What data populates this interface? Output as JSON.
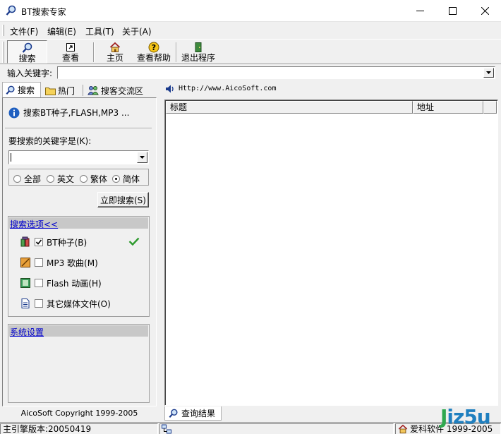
{
  "window": {
    "title": "BT搜索专家"
  },
  "menu": {
    "items": [
      "文件(F)",
      "编辑(E)",
      "工具(T)",
      "关于(A)"
    ]
  },
  "toolbar": {
    "buttons": [
      {
        "label": "搜索",
        "icon": "search-icon",
        "pressed": true
      },
      {
        "label": "查看",
        "icon": "view-icon",
        "pressed": false
      },
      {
        "label": "主页",
        "icon": "home-icon",
        "pressed": false
      },
      {
        "label": "查看帮助",
        "icon": "help-icon",
        "pressed": false
      },
      {
        "label": "退出程序",
        "icon": "exit-icon",
        "pressed": false
      }
    ]
  },
  "keyword_bar": {
    "label": "输入关键字:",
    "value": ""
  },
  "left_tabs": [
    "搜索",
    "热门",
    "搜客交流区"
  ],
  "search_panel": {
    "info": "搜索BT种子,FLASH,MP3 ...",
    "keyword_label": "要搜索的关键字是(K):",
    "keyword_value": "",
    "radios": [
      {
        "label": "全部",
        "checked": false
      },
      {
        "label": "英文",
        "checked": false
      },
      {
        "label": "繁体",
        "checked": false
      },
      {
        "label": "简体",
        "checked": true
      }
    ],
    "search_button": "立即搜索(S)",
    "options_header": "搜索选项<<",
    "options": [
      {
        "label": "BT种子(B)",
        "checked": true,
        "icon": "bt-seed-icon"
      },
      {
        "label": "MP3 歌曲(M)",
        "checked": false,
        "icon": "mp3-icon"
      },
      {
        "label": "Flash 动画(H)",
        "checked": false,
        "icon": "flash-icon"
      },
      {
        "label": "其它媒体文件(O)",
        "checked": false,
        "icon": "document-icon"
      }
    ],
    "settings_header": "系统设置"
  },
  "left_footer": "AicoSoft Copyright 1999-2005",
  "address": {
    "url": "Http://www.AicoSoft.com"
  },
  "results": {
    "columns": [
      "标题",
      "地址"
    ],
    "tab_label": "查询结果"
  },
  "status": {
    "engine_version": "主引擎版本:20050419",
    "copyright": "爱科软件 1999-2005"
  },
  "watermark": {
    "text_j": "J",
    "text_rest": "iz5u"
  },
  "colors": {
    "link": "#0000cc",
    "section_bg": "#c8c8c8",
    "check_green": "#2e9a2e"
  }
}
